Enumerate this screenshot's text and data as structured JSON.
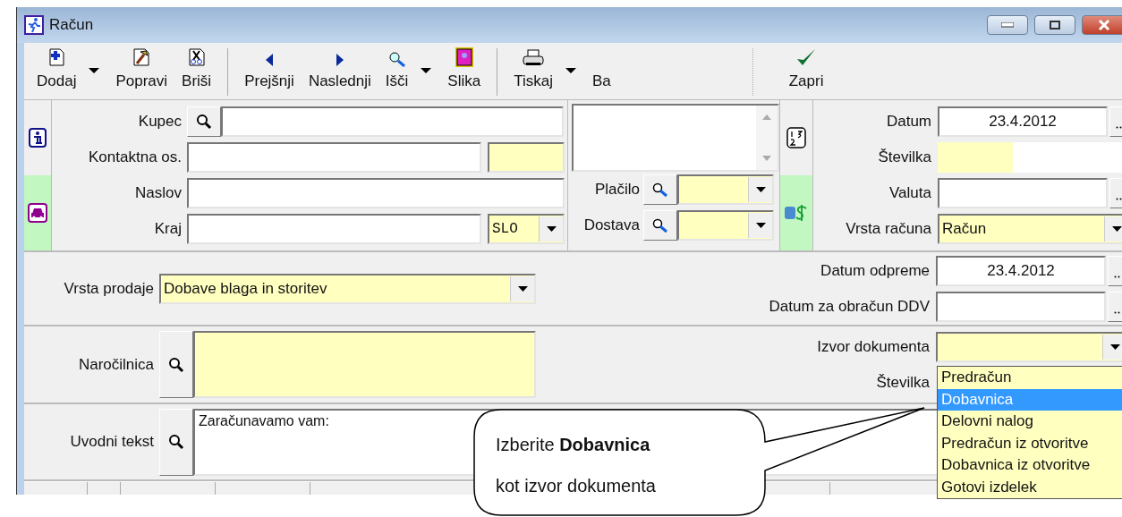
{
  "window": {
    "title": "Račun"
  },
  "toolbar": [
    {
      "label": "Dodaj",
      "menu": true,
      "separator_before": false
    },
    {
      "label": "Popravi",
      "menu": false,
      "separator_before": false
    },
    {
      "label": "Briši",
      "menu": false,
      "separator_before": false
    },
    {
      "label": "Prejšnji",
      "menu": false,
      "separator_before": true
    },
    {
      "label": "Naslednji",
      "menu": false,
      "separator_before": false
    },
    {
      "label": "Išči",
      "menu": true,
      "separator_before": false
    },
    {
      "label": "Slika",
      "menu": false,
      "separator_before": false
    },
    {
      "label": "Tiskaj",
      "menu": true,
      "separator_before": true
    },
    {
      "label": "Ba",
      "menu": false,
      "separator_before": false
    },
    {
      "label": "Zapri",
      "menu": false,
      "separator_before": true
    }
  ],
  "partner": {
    "kupec": {
      "label": "Kupec",
      "required": false
    },
    "kontakt": {
      "label": "Kontaktna os.",
      "required": false,
      "code_required": true
    },
    "naslov": {
      "label": "Naslov",
      "required": false
    },
    "kraj": {
      "label": "Kraj",
      "required": false,
      "country": "SLO"
    }
  },
  "terms": [
    {
      "label": "Plačilo",
      "required": true
    },
    {
      "label": "Dostava",
      "required": true
    }
  ],
  "header": [
    {
      "kind": "date",
      "label": "Datum",
      "value": "23.4.2012",
      "required": false
    },
    {
      "kind": "number",
      "label": "Številka",
      "required": true
    },
    {
      "kind": "picker",
      "label": "Valuta",
      "required": false
    },
    {
      "kind": "combo",
      "label": "Vrsta računa",
      "value": "Račun",
      "required": true
    }
  ],
  "sale_type": {
    "label": "Vrsta prodaje",
    "value": "Dobave blaga in storitev",
    "required": true
  },
  "dates": [
    {
      "label": "Datum odpreme",
      "value": "23.4.2012"
    },
    {
      "label": "Datum za obračun DDV"
    }
  ],
  "order": {
    "label": "Naročilnica",
    "required": true
  },
  "source": {
    "label": "Izvor dokumenta",
    "number_label": "Številka",
    "required": true,
    "options": [
      {
        "label": "Predračun",
        "selected": false
      },
      {
        "label": "Dobavnica",
        "selected": true
      },
      {
        "label": "Delovni nalog",
        "selected": false
      },
      {
        "label": "Predračun iz otvoritve",
        "selected": false
      },
      {
        "label": "Dobavnica iz otvoritve",
        "selected": false
      },
      {
        "label": "Gotovi izdelek",
        "selected": false
      }
    ]
  },
  "intro": {
    "label": "Uvodni tekst",
    "value": "Zaračunavamo vam:"
  },
  "callout": {
    "lines": [
      "Izberite **Dobavnica**",
      "kot izvor dokumenta"
    ]
  }
}
